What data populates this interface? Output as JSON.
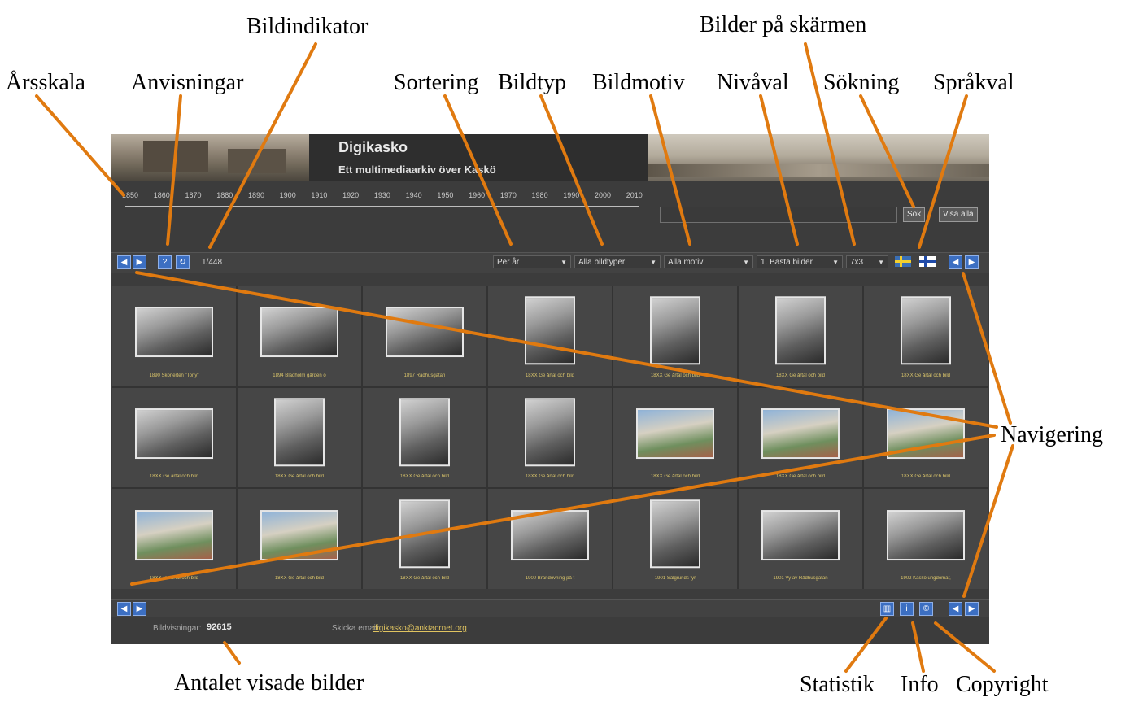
{
  "annotations": {
    "arsskala": "Årsskala",
    "anvisningar": "Anvisningar",
    "bildindikator": "Bildindikator",
    "sortering": "Sortering",
    "bildtyp": "Bildtyp",
    "bildmotiv": "Bildmotiv",
    "nivaval": "Nivåval",
    "sokning": "Sökning",
    "sprakval": "Språkval",
    "bilder_pa_skarmen": "Bilder på skärmen",
    "navigering": "Navigering",
    "antalet_visade_bilder": "Antalet visade bilder",
    "statistik": "Statistik",
    "info": "Info",
    "copyright": "Copyright"
  },
  "app": {
    "title": "Digikasko",
    "subtitle": "Ett multimediaarkiv över Kaskö",
    "timeline_years": [
      "1850",
      "1860",
      "1870",
      "1880",
      "1890",
      "1900",
      "1910",
      "1920",
      "1930",
      "1940",
      "1950",
      "1960",
      "1970",
      "1980",
      "1990",
      "2000",
      "2010"
    ],
    "search_placeholder": "",
    "search_button": "Sök",
    "show_all_button": "Visa alla",
    "indicator": "1/448",
    "sort_selected": "Per år",
    "type_selected": "Alla bildtyper",
    "motif_selected": "Alla motiv",
    "level_selected": "1. Bästa bilder",
    "per_screen_selected": "7x3",
    "count_label": "Bildvisningar:",
    "count_value": "92615",
    "email_label": "Skicka email:",
    "email": "digikasko@anktacrnet.org"
  },
  "icons": {
    "prev": "prev-arrow-icon",
    "next": "next-arrow-icon",
    "help": "help-icon",
    "refresh": "refresh-icon",
    "statistics": "statistics-icon",
    "info": "info-icon",
    "copyright": "copyright-icon",
    "swedish_flag": "swedish-flag-icon",
    "finnish_flag": "finnish-flag-icon"
  },
  "thumbnails": [
    {
      "caption": "1890 Skonerten \"Tony\"",
      "shape": "land",
      "tone": "bw"
    },
    {
      "caption": "1894 Bladholm gården o",
      "shape": "land",
      "tone": "bw"
    },
    {
      "caption": "1897 Rådhusgatan",
      "shape": "land",
      "tone": "bw"
    },
    {
      "caption": "18XX Ge årtal och bild",
      "shape": "port",
      "tone": "bw"
    },
    {
      "caption": "18XX Ge årtal och bild",
      "shape": "port",
      "tone": "bw"
    },
    {
      "caption": "18XX Ge årtal och bild",
      "shape": "port",
      "tone": "bw"
    },
    {
      "caption": "18XX Ge årtal och bild",
      "shape": "port",
      "tone": "bw"
    },
    {
      "caption": "18XX Ge årtal och bild",
      "shape": "land",
      "tone": "bw"
    },
    {
      "caption": "18XX Ge årtal och bild",
      "shape": "port",
      "tone": "bw"
    },
    {
      "caption": "18XX Ge årtal och bild",
      "shape": "port",
      "tone": "bw"
    },
    {
      "caption": "18XX Ge årtal och bild",
      "shape": "port",
      "tone": "bw"
    },
    {
      "caption": "18XX Ge årtal och bild",
      "shape": "land",
      "tone": "color"
    },
    {
      "caption": "18XX Ge årtal och bild",
      "shape": "land",
      "tone": "color"
    },
    {
      "caption": "18XX Ge årtal och bild",
      "shape": "land",
      "tone": "color"
    },
    {
      "caption": "18XX Ge årtal och bild",
      "shape": "land",
      "tone": "color"
    },
    {
      "caption": "18XX Ge årtal och bild",
      "shape": "land",
      "tone": "color"
    },
    {
      "caption": "18XX Ge årtal och bild",
      "shape": "port",
      "tone": "bw"
    },
    {
      "caption": "1900 Brandövning på t",
      "shape": "land",
      "tone": "bw"
    },
    {
      "caption": "1901 Sälgrunds fyr",
      "shape": "port",
      "tone": "bw"
    },
    {
      "caption": "1901 Vy av Rådhusgatan",
      "shape": "land",
      "tone": "bw"
    },
    {
      "caption": "1902 Kaskö ungdomar,",
      "shape": "land",
      "tone": "bw"
    }
  ]
}
